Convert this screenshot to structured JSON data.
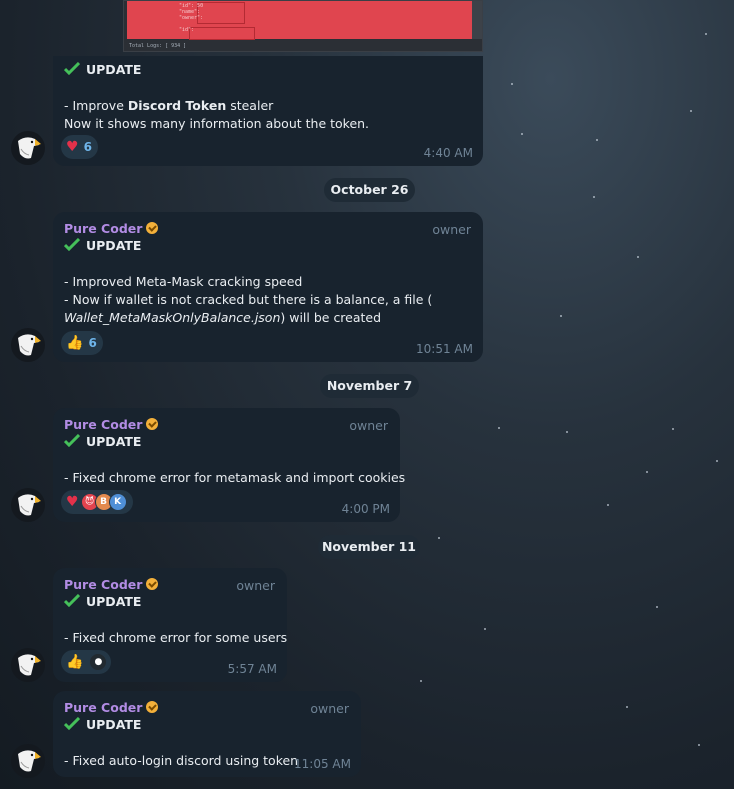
{
  "preview": {
    "footer": "Total Logs: [ 934 ]"
  },
  "messages": [
    {
      "title": "UPDATE",
      "lines": [
        "- Improve ",
        "Discord Token",
        " stealer",
        "Now it shows many information about the token."
      ],
      "reaction_count": "6",
      "time": "4:40 AM"
    },
    {
      "sender": "Pure Coder",
      "role": "owner",
      "title": "UPDATE",
      "lines": [
        "- Improved Meta-Mask cracking speed",
        "- Now if wallet is not cracked but there is a balance, a file (",
        "Wallet_MetaMaskOnlyBalance.json",
        ") will be created"
      ],
      "reaction_count": "6",
      "time": "10:51 AM"
    },
    {
      "sender": "Pure Coder",
      "role": "owner",
      "title": "UPDATE",
      "lines": [
        "- Fixed chrome error for metamask and import cookies"
      ],
      "reactors": [
        "B",
        "K"
      ],
      "time": "4:00 PM"
    },
    {
      "sender": "Pure Coder",
      "role": "owner",
      "title": "UPDATE",
      "lines": [
        "- Fixed chrome error for some users"
      ],
      "time": "5:57 AM"
    },
    {
      "sender": "Pure Coder",
      "role": "owner",
      "title": "UPDATE",
      "lines": [
        "- Fixed auto-login discord using token"
      ],
      "time": "11:05 AM"
    }
  ],
  "dates": [
    "October 26",
    "November 7",
    "November 11"
  ],
  "icons": {
    "check": "green-checkmark-icon",
    "heart": "red-heart-icon",
    "thumbs": "thumbs-up-icon",
    "badge": "verified-badge-icon",
    "avatar": "eagle-avatar-icon"
  },
  "colors": {
    "sender": "#b28ce4",
    "bubble": "#18232e",
    "reaction_count": "#6fb5ea"
  }
}
